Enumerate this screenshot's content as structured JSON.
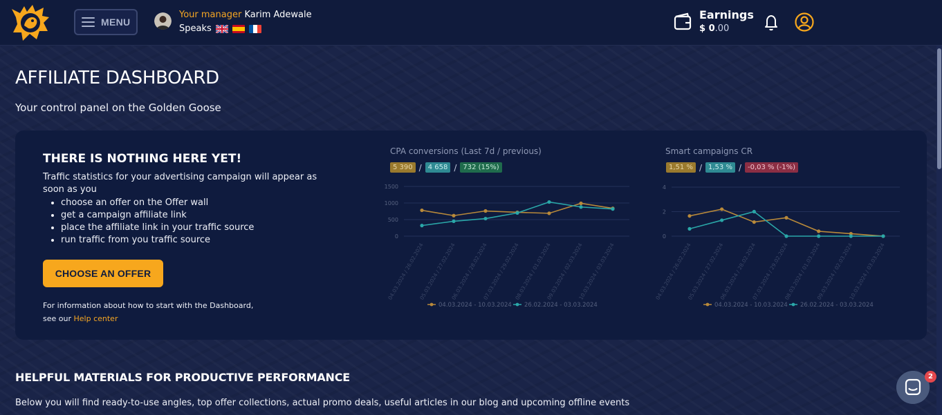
{
  "header": {
    "menu_label": "MENU",
    "manager_prefix": "Your manager",
    "manager_name": "Karim Adewale",
    "speaks_label": "Speaks",
    "languages": [
      "uk-flag-icon",
      "es-flag-icon",
      "fr-flag-icon"
    ],
    "earnings_label": "Earnings",
    "earnings_currency": "$",
    "earnings_int": "0",
    "earnings_dec": ".00"
  },
  "page": {
    "title": "AFFILIATE DASHBOARD",
    "subtitle": "Your control panel on the Golden Goose"
  },
  "empty_state": {
    "title": "THERE IS NOTHING HERE YET!",
    "text": "Traffic statistics for your advertising campaign will appear as soon as you",
    "steps": [
      "choose an offer on the Offer wall",
      "get a campaign affiliate link",
      "place the affiliate link in your traffic source",
      "run traffic from you traffic source"
    ],
    "cta_label": "CHOOSE AN OFFER",
    "info_line1": "For information about how to start with the Dashboard,",
    "info_prefix": "see our",
    "info_link": "Help center"
  },
  "section": {
    "title": "HELPFUL MATERIALS FOR PRODUCTIVE PERFORMANCE",
    "text": "Below you will find ready-to-use angles, top offer collections, actual promo deals, useful articles in our blog and upcoming offline events"
  },
  "chat": {
    "badge": "2"
  },
  "colors": {
    "accent": "#f7a71d",
    "series_current": "#b8893a",
    "series_previous": "#2aa7a8",
    "panel_bg": "#0f1b3e",
    "header_bg": "#101b3c"
  },
  "chart_data": [
    {
      "type": "line",
      "title": "CPA conversions",
      "subtitle": "(Last 7d / previous)",
      "chips": [
        "5 390",
        "4 658",
        "732 (15%)"
      ],
      "categories": [
        "04.03.2024 / 26.02.2024",
        "05.03.2024 / 27.02.2024",
        "06.03.2024 / 28.02.2024",
        "07.03.2024 / 29.02.2024",
        "08.03.2024 / 01.03.2024",
        "09.03.2024 / 02.03.2024",
        "10.03.2024 / 03.03.2024"
      ],
      "series": [
        {
          "name": "04.03.2024 - 10.03.2024",
          "values": [
            780,
            620,
            760,
            720,
            690,
            990,
            840
          ]
        },
        {
          "name": "26.02.2024 - 03.03.2024",
          "values": [
            320,
            450,
            530,
            700,
            1030,
            880,
            820
          ]
        }
      ],
      "yticks": [
        "0",
        "500",
        "1000",
        "1500"
      ],
      "ylim": [
        0,
        1500
      ],
      "legend": "bottom"
    },
    {
      "type": "line",
      "title": "Smart campaigns CR",
      "chips": [
        "1,51 %",
        "1,53 %",
        "-0,03 % (-1%)"
      ],
      "categories": [
        "04.03.2024 / 26.02.2024",
        "05.03.2024 / 27.02.2024",
        "06.03.2024 / 28.02.2024",
        "07.03.2024 / 29.02.2024",
        "08.03.2024 / 01.03.2024",
        "09.03.2024 / 02.03.2024",
        "10.03.2024 / 03.03.2024"
      ],
      "series": [
        {
          "name": "04.03.2024 - 10.03.2024",
          "values": [
            1.65,
            2.2,
            1.15,
            1.5,
            0.4,
            0.2,
            0
          ]
        },
        {
          "name": "26.02.2024 - 03.03.2024",
          "values": [
            0.6,
            1.3,
            2.0,
            0,
            0,
            0,
            0
          ]
        }
      ],
      "yticks": [
        "0",
        "2",
        "4"
      ],
      "ylim": [
        0,
        4
      ],
      "legend": "bottom"
    }
  ]
}
